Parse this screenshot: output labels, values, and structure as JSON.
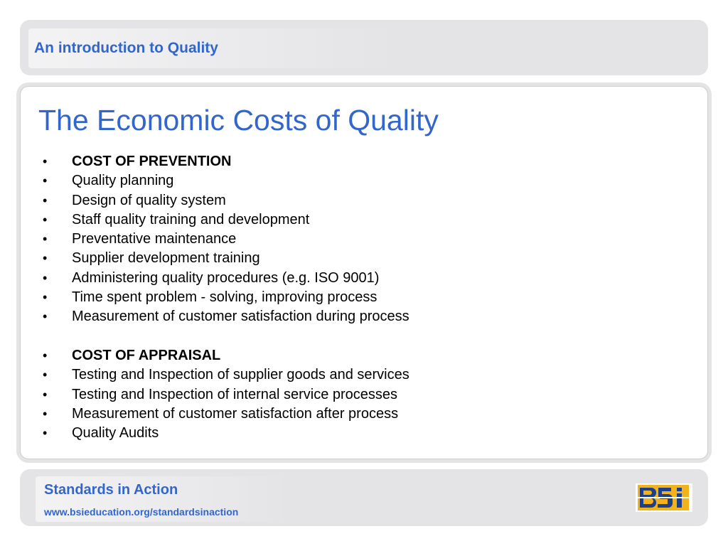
{
  "header": {
    "title": "An introduction to Quality"
  },
  "slide": {
    "title": "The Economic Costs of Quality",
    "bullet_char": "•",
    "prevention": {
      "heading": "COST OF PREVENTION",
      "items": [
        "Quality planning",
        "Design of quality system",
        "Staff quality training and development",
        "Preventative maintenance",
        "Supplier development training",
        "Administering quality procedures (e.g. ISO 9001)",
        "Time spent problem - solving, improving process",
        "Measurement of customer satisfaction during process"
      ]
    },
    "appraisal": {
      "heading": "COST OF APPRAISAL",
      "items": [
        "Testing and Inspection of supplier goods and services",
        "Testing and Inspection of internal service processes",
        "Measurement of customer satisfaction after process",
        "Quality Audits"
      ]
    }
  },
  "footer": {
    "title": "Standards in Action",
    "url": "www.bsieducation.org/standardsinaction",
    "logo_text": "BSi",
    "logo_icon": "bsi-logo-icon"
  },
  "colors": {
    "accent": "#3366cc",
    "band": "#e4e4e6",
    "logo_blue": "#1e3f8a",
    "logo_gold": "#f2b21c"
  }
}
